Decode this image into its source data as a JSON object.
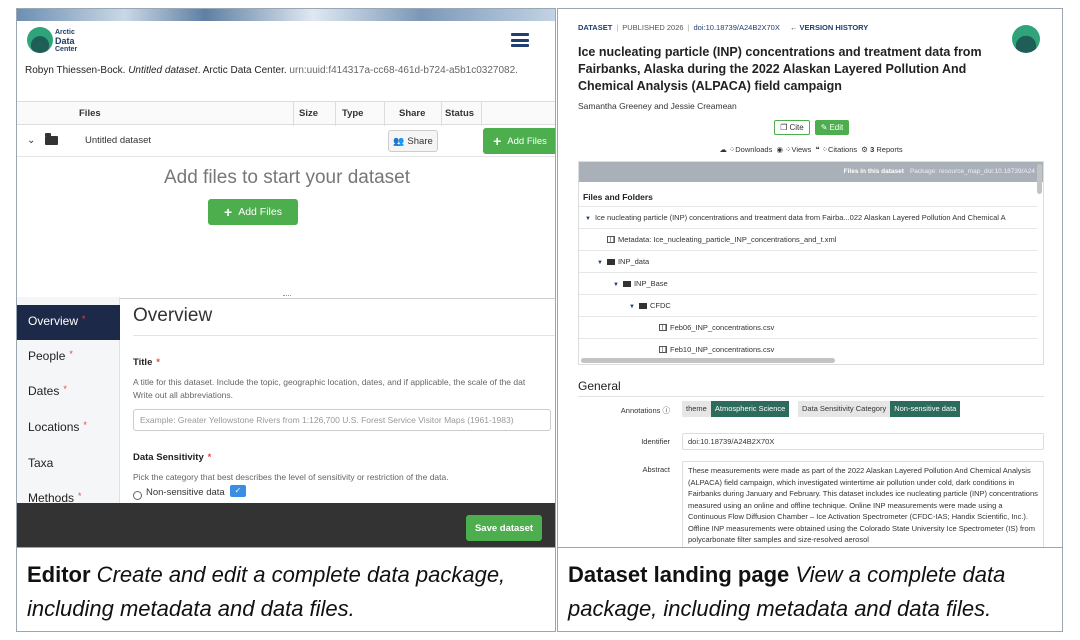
{
  "editor": {
    "logo": {
      "line1": "Arctic",
      "line2": "Data",
      "line3": "Center"
    },
    "citation": {
      "main": "Robyn Thiessen-Bock. ",
      "title": "Untitled dataset",
      "rest": ". Arctic Data Center. ",
      "urn": "urn:uuid:f414317a-cc68-461d-b724-a5b1c0327082."
    },
    "files_table": {
      "headers": {
        "files": "Files",
        "size": "Size",
        "type": "Type",
        "share": "Share",
        "status": "Status"
      },
      "row": {
        "name": "Untitled dataset",
        "share_label": "Share",
        "add_label": "Add Files"
      }
    },
    "empty_state": {
      "title": "Add files to start your dataset",
      "button": "Add Files"
    },
    "nav": [
      {
        "label": "Overview",
        "required": "*"
      },
      {
        "label": "People",
        "required": "*"
      },
      {
        "label": "Dates",
        "required": "*"
      },
      {
        "label": "Locations",
        "required": "*"
      },
      {
        "label": "Taxa",
        "required": ""
      },
      {
        "label": "Methods",
        "required": "*"
      }
    ],
    "overview": {
      "heading": "Overview",
      "title_label": "Title",
      "title_required": "*",
      "title_help_1": "A title for this dataset. Include the topic, geographic location, dates, and if applicable, the scale of the dat",
      "title_help_2": "Write out all abbreviations.",
      "title_placeholder": "Example: Greater Yellowstone Rivers from 1:126,700 U.S. Forest Service Visitor Maps (1961-1983)",
      "sensitivity_label": "Data Sensitivity",
      "sensitivity_required": "*",
      "sensitivity_help": "Pick the category that best describes the level of sensitivity or restriction of the data.",
      "option_1": "Non-sensitive data"
    },
    "save_button": "Save dataset"
  },
  "landing": {
    "crumbs": {
      "dataset": "DATASET",
      "published": "PUBLISHED 2026",
      "doi": "doi:10.18739/A24B2X70X",
      "version_history": "VERSION HISTORY"
    },
    "title": "Ice nucleating particle (INP) concentrations and treatment data from Fairbanks, Alaska during the 2022 Alaskan Layered Pollution And Chemical Analysis (ALPACA) field campaign",
    "authors": "Samantha Greeney and Jessie Creamean",
    "cite_button": "Cite",
    "edit_button": "Edit",
    "metrics": {
      "downloads": "Downloads",
      "views": "Views",
      "citations": "Citations",
      "reports_count": "3",
      "reports": "Reports"
    },
    "files_box": {
      "header": "Files in this dataset",
      "package": "Package: resource_map_doi:10.18739/A24",
      "label": "Files and Folders",
      "rows": [
        {
          "text": "Ice nucleating particle (INP) concentrations and treatment data from Fairba...022 Alaskan Layered Pollution And Chemical A",
          "kind": "root"
        },
        {
          "text": "Metadata: Ice_nucleating_particle_INP_concentrations_and_t.xml",
          "kind": "meta"
        },
        {
          "text": "INP_data",
          "kind": "folder"
        },
        {
          "text": "INP_Base",
          "kind": "folder"
        },
        {
          "text": "CFDC",
          "kind": "folder"
        },
        {
          "text": "Feb06_INP_concentrations.csv",
          "kind": "file"
        },
        {
          "text": "Feb10_INP_concentrations.csv",
          "kind": "file"
        }
      ]
    },
    "general": {
      "heading": "General",
      "annotations_label": "Annotations",
      "ann_1_key": "theme",
      "ann_1_val": "Atmospheric Science",
      "ann_2_key": "Data Sensitivity Category",
      "ann_2_val": "Non-sensitive data",
      "identifier_label": "Identifier",
      "identifier": "doi:10.18739/A24B2X70X",
      "abstract_label": "Abstract",
      "abstract": "These measurements were made as part of the 2022 Alaskan Layered Pollution And Chemical Analysis (ALPACA) field campaign, which investigated wintertime air pollution under cold, dark conditions in Fairbanks during January and February. This dataset includes ice nucleating particle (INP) concentrations measured using an online and offline technique. Online INP measurements were made using a Continuous Flow Diffusion Chamber – Ice Activation Spectrometer (CFDC-IAS; Handix Scientific, Inc.). Offline INP measurements were obtained using the Colorado State University Ice Spectrometer (IS) from polycarbonate filter samples and size-resolved aerosol"
    }
  },
  "captions": {
    "left_bold": "Editor",
    "left_text": " Create and edit a complete data package, including metadata and data files.",
    "right_bold": "Dataset landing page",
    "right_text": " View a complete data package, including metadata and data files."
  },
  "colors": {
    "accent_green": "#4cae4c",
    "nav_active": "#1d2948",
    "annotation_teal": "#2d6b5c",
    "brand_navy": "#1f3f6e"
  }
}
